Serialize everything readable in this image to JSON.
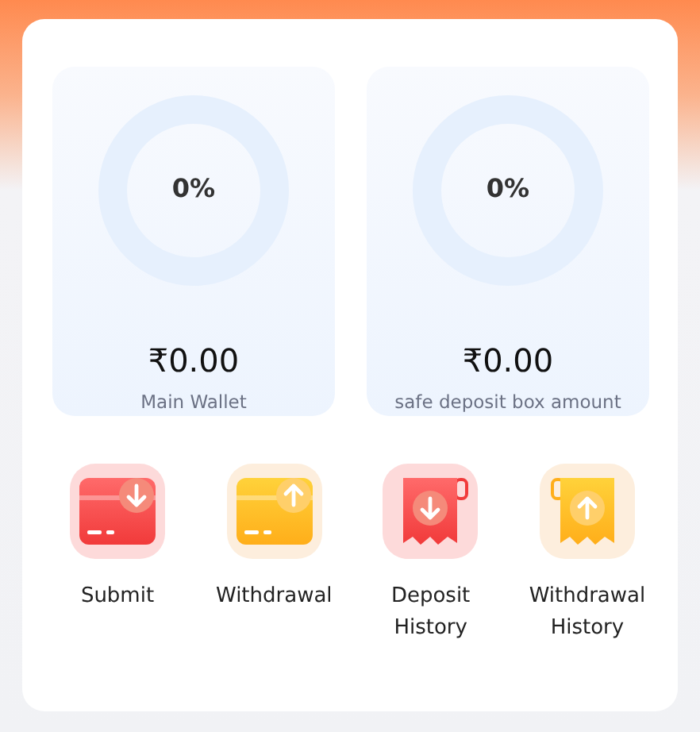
{
  "wallets": [
    {
      "percent": "0%",
      "amount": "₹0.00",
      "label": "Main Wallet"
    },
    {
      "percent": "0%",
      "amount": "₹0.00",
      "label": "safe deposit box amount"
    }
  ],
  "actions": [
    {
      "label": "Submit",
      "kind": "deposit-card"
    },
    {
      "label": "Withdrawal",
      "kind": "withdraw-card"
    },
    {
      "label": "Deposit History",
      "kind": "deposit-receipt"
    },
    {
      "label": "Withdrawal History",
      "kind": "withdraw-receipt"
    }
  ]
}
